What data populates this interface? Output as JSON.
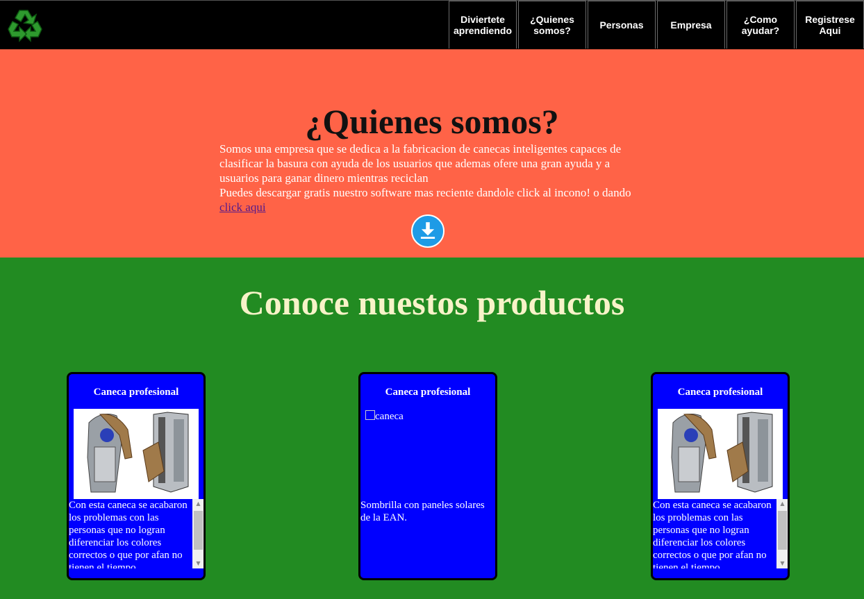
{
  "header": {
    "logo_icon": "recycle-icon",
    "nav": [
      "Diviertete\naprendiendo",
      "¿Quienes\nsomos?",
      "Personas",
      "Empresa",
      "¿Como\nayudar?",
      "Registrese\nAqui"
    ]
  },
  "about": {
    "title": "¿Quienes somos?",
    "text": "Somos una empresa que se dedica a la fabricacion de canecas inteligentes capaces de clasificar la basura con ayuda de los usuarios que ademas ofere una gran ayuda y a usuarios para ganar dinero mientras reciclan",
    "download_text": "Puedes descargar gratis nuestro software mas reciente dandole click al incono! o dando ",
    "link_label": "click aqui",
    "download_icon": "download-icon",
    "colors": {
      "background": "#FF6347",
      "icon": "#1e9be6"
    }
  },
  "products": {
    "title": "Conoce nuestos productos",
    "cards": [
      {
        "title": "Caneca profesional",
        "text": "Con esta caneca se acabaron los problemas con las personas que no logran diferenciar los colores correctos o que por afan no tienen el tiempo"
      },
      {
        "title": "Caneca profesional",
        "img_alt": "caneca",
        "text": "Sombrilla con paneles solares de la EAN."
      },
      {
        "title": "Caneca profesional",
        "text": "Con esta caneca se acabaron los problemas con las personas que no logran diferenciar los colores correctos o que por afan no tienen el tiempo"
      }
    ],
    "colors": {
      "background": "#228B22",
      "card": "#0000FF"
    }
  }
}
